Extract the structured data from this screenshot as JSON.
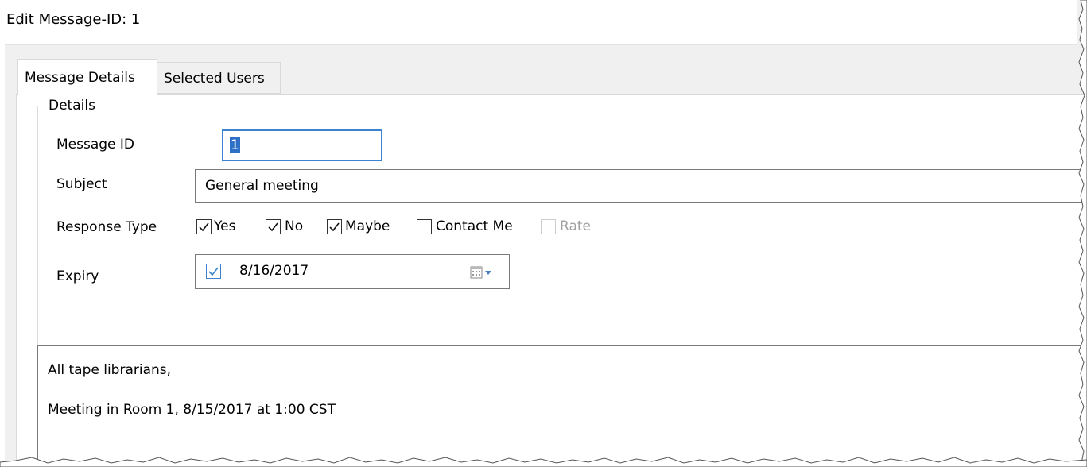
{
  "window": {
    "title": "Edit Message-ID: 1"
  },
  "tabs": [
    {
      "label": "Message Details",
      "active": true
    },
    {
      "label": "Selected Users",
      "active": false
    }
  ],
  "details": {
    "legend": "Details",
    "message_id": {
      "label": "Message ID",
      "value": "1"
    },
    "subject": {
      "label": "Subject",
      "value": "General meeting"
    },
    "response_type": {
      "label": "Response Type",
      "options": [
        {
          "label": "Yes",
          "checked": true,
          "enabled": true
        },
        {
          "label": "No",
          "checked": true,
          "enabled": true
        },
        {
          "label": "Maybe",
          "checked": true,
          "enabled": true
        },
        {
          "label": "Contact Me",
          "checked": false,
          "enabled": true
        },
        {
          "label": "Rate",
          "checked": false,
          "enabled": false
        }
      ]
    },
    "expiry": {
      "label": "Expiry",
      "checked": true,
      "value": "8/16/2017",
      "icon": "calendar-dropdown-icon"
    }
  },
  "message_body": {
    "lines": [
      "All tape librarians,",
      "",
      "Meeting in Room 1, 8/15/2017 at 1:00 CST"
    ]
  },
  "colors": {
    "focus_border": "#3b83d0",
    "selection": "#2e70c6",
    "panel_bg": "#f0f0f0"
  }
}
